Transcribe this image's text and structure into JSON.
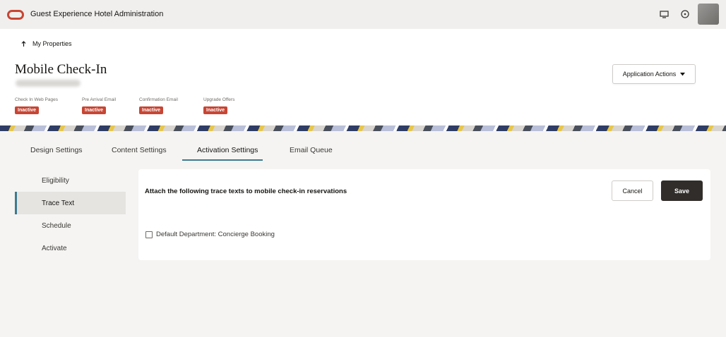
{
  "app": {
    "title": "Guest Experience Hotel Administration",
    "brand_color": "#c74634",
    "icons": [
      "display-icon",
      "help-icon",
      "avatar"
    ]
  },
  "header": {
    "back_label": "My Properties",
    "page_title": "Mobile Check-In",
    "application_actions_label": "Application Actions",
    "statuses": [
      {
        "label": "Check In Web Pages",
        "badge": "Inactive"
      },
      {
        "label": "Pre Arrival Email",
        "badge": "Inactive"
      },
      {
        "label": "Confirmation Email",
        "badge": "Inactive"
      },
      {
        "label": "Upgrade Offers",
        "badge": "Inactive"
      }
    ],
    "badge_color": "#c74634"
  },
  "tabs": [
    {
      "label": "Design Settings",
      "active": false
    },
    {
      "label": "Content Settings",
      "active": false
    },
    {
      "label": "Activation Settings",
      "active": true
    },
    {
      "label": "Email Queue",
      "active": false
    }
  ],
  "sidenav": [
    {
      "label": "Eligibility",
      "active": false
    },
    {
      "label": "Trace Text",
      "active": true
    },
    {
      "label": "Schedule",
      "active": false
    },
    {
      "label": "Activate",
      "active": false
    }
  ],
  "panel": {
    "heading": "Attach the following trace texts to mobile check-in reservations",
    "cancel_label": "Cancel",
    "save_label": "Save",
    "checkbox_label": "Default Department: Concierge Booking",
    "checkbox_checked": false
  },
  "accent_color": "#3d7b8f"
}
